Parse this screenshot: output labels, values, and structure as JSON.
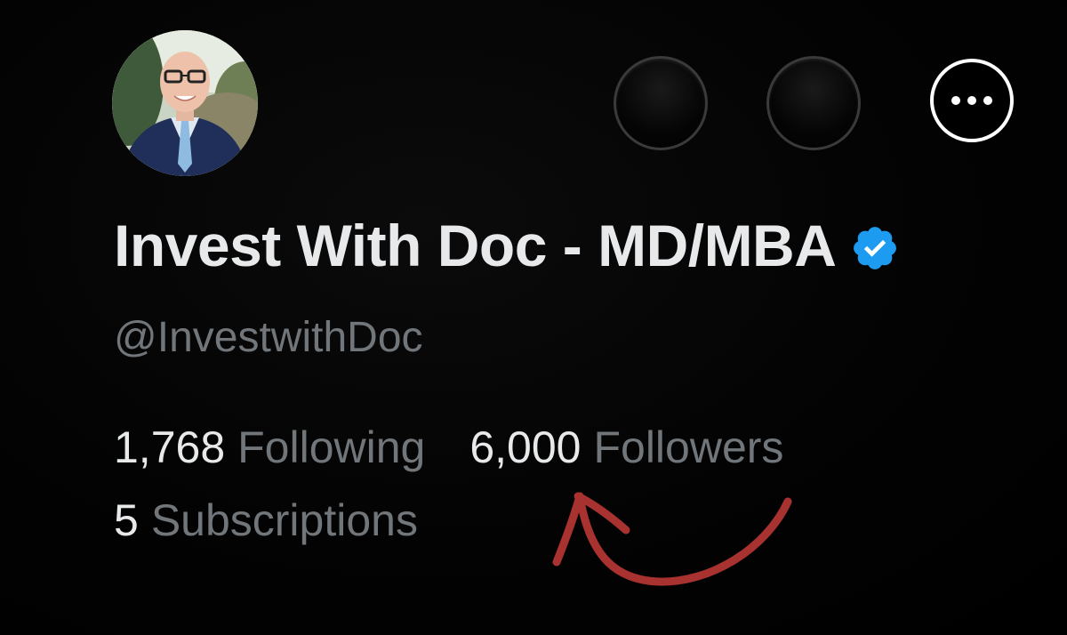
{
  "profile": {
    "display_name": "Invest With Doc - MD/MBA",
    "handle": "@InvestwithDoc",
    "verified_icon": "verified-badge-icon"
  },
  "actions": {
    "more_icon": "more-horizontal-icon"
  },
  "stats": {
    "following_count": "1,768",
    "following_label": "Following",
    "followers_count": "6,000",
    "followers_label": "Followers",
    "subscriptions_count": "5",
    "subscriptions_label": "Subscriptions"
  },
  "colors": {
    "background": "#000000",
    "primary_text": "#e7e9ea",
    "secondary_text": "#71767b",
    "verified_blue": "#1d9bf0",
    "annotation_red": "#a8322f"
  }
}
